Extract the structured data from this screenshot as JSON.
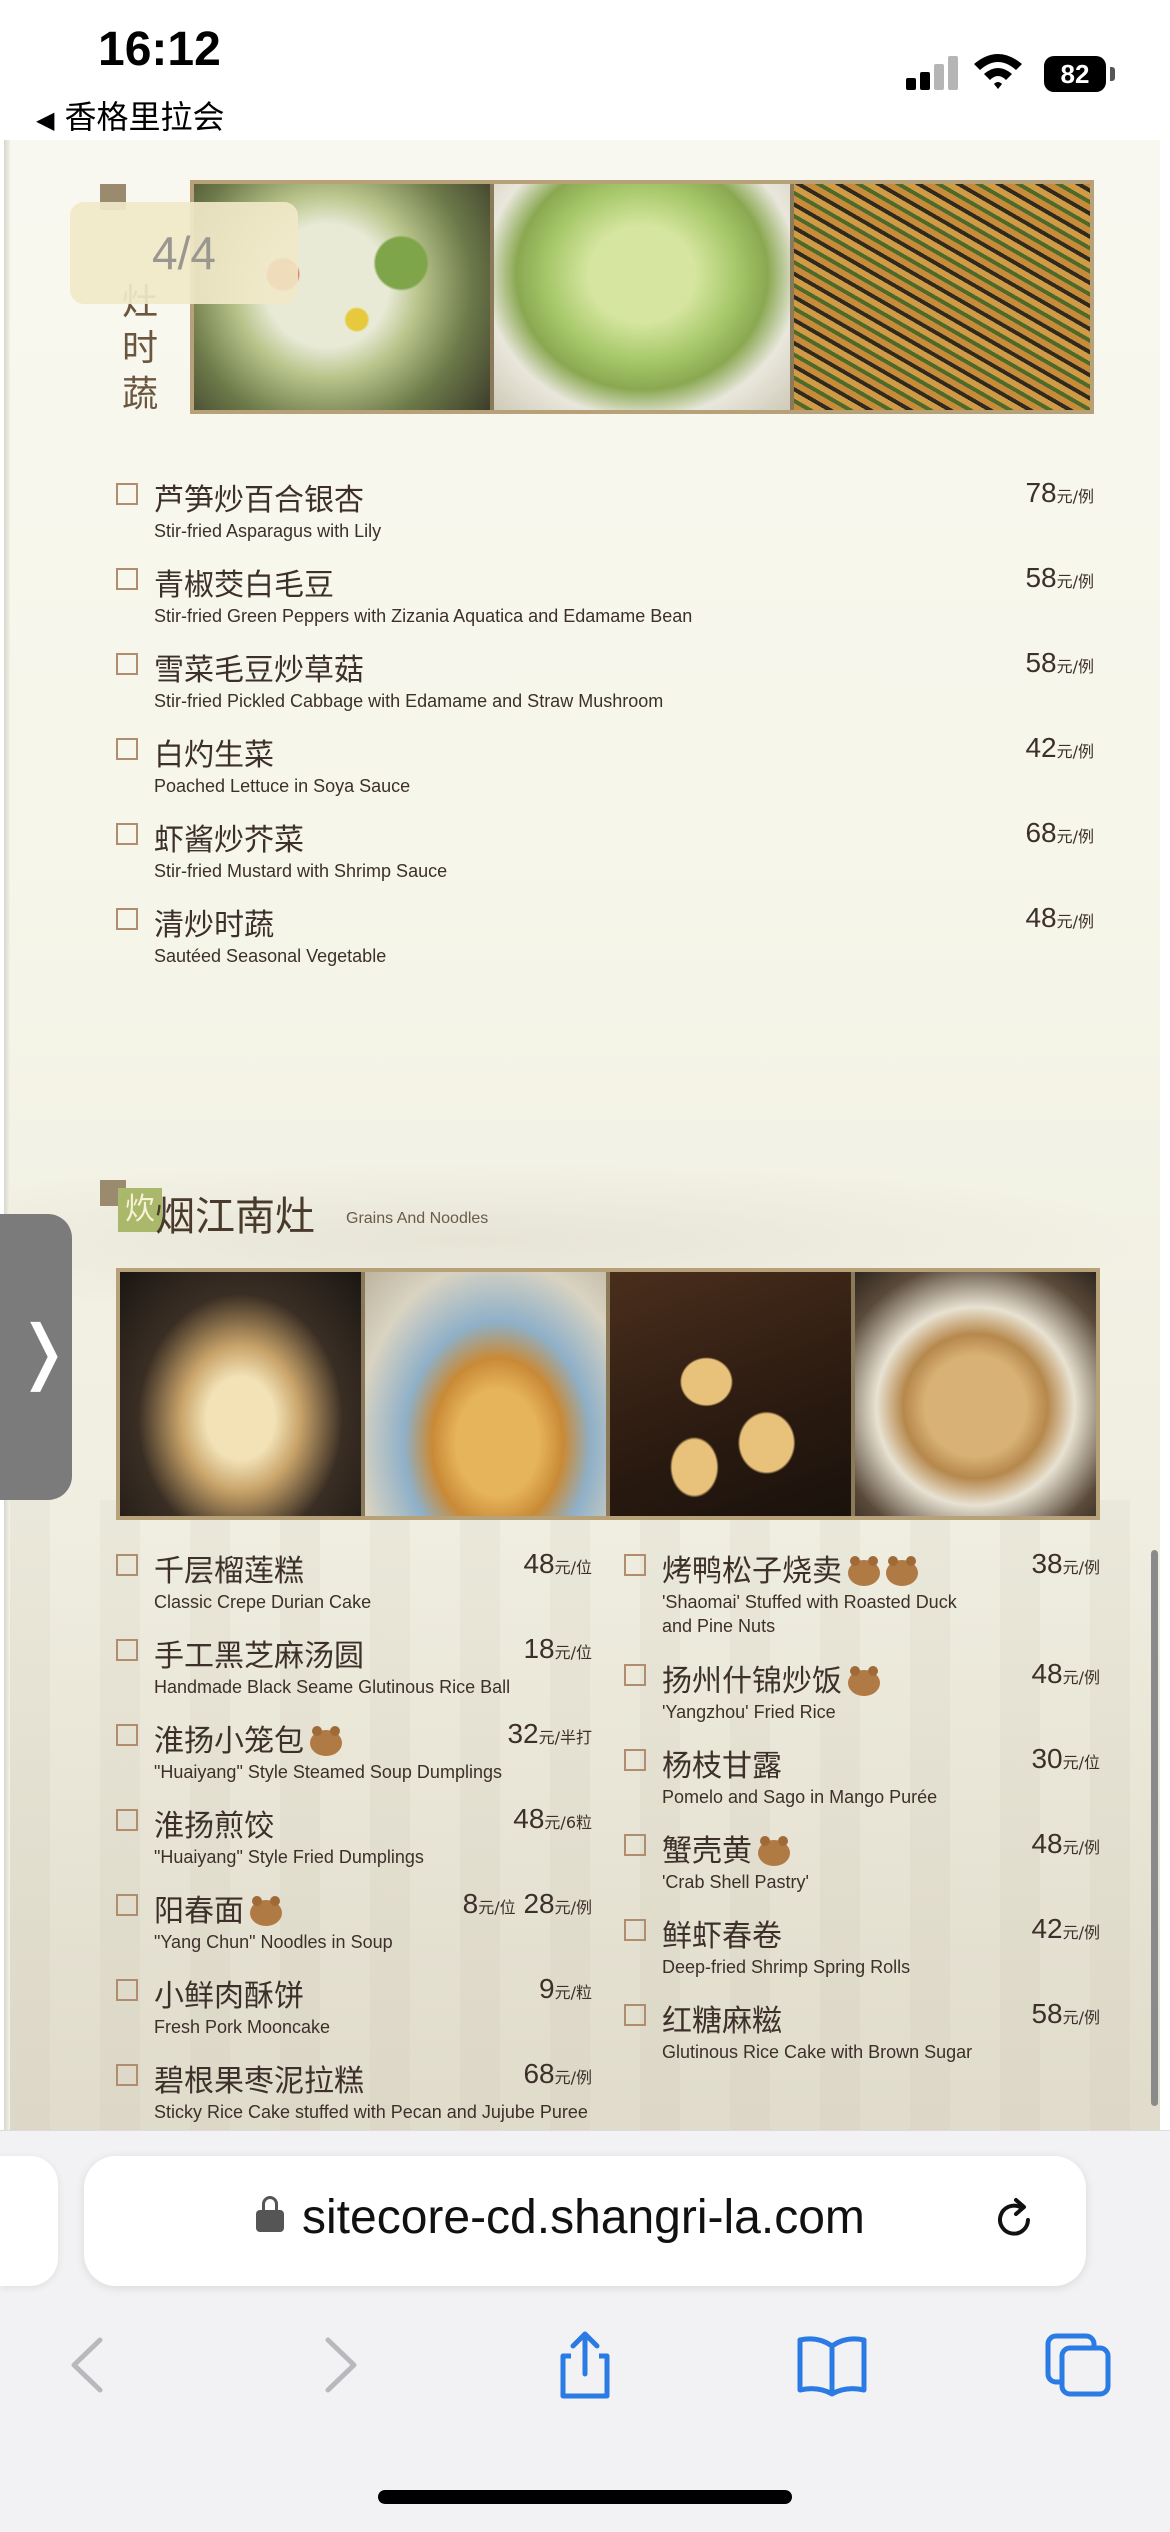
{
  "status_bar": {
    "time": "16:12",
    "back_app": "香格里拉会",
    "battery": "82"
  },
  "page_indicator": "4/4",
  "vegetables": {
    "title_chars": [
      "灶",
      "时",
      "蔬"
    ],
    "items": [
      {
        "zh": "芦笋炒百合银杏",
        "en": "Stir-fried Asparagus with Lily",
        "price": "78",
        "unit": "元/例"
      },
      {
        "zh": "青椒茭白毛豆",
        "en": "Stir-fried Green Peppers with Zizania Aquatica and Edamame Bean",
        "price": "58",
        "unit": "元/例"
      },
      {
        "zh": "雪菜毛豆炒草菇",
        "en": "Stir-fried Pickled Cabbage with Edamame and Straw Mushroom",
        "price": "58",
        "unit": "元/例"
      },
      {
        "zh": "白灼生菜",
        "en": "Poached Lettuce in Soya Sauce",
        "price": "42",
        "unit": "元/例"
      },
      {
        "zh": "虾酱炒芥菜",
        "en": "Stir-fried Mustard with Shrimp Sauce",
        "price": "68",
        "unit": "元/例"
      },
      {
        "zh": "清炒时蔬",
        "en": "Sautéed Seasonal Vegetable",
        "price": "48",
        "unit": "元/例"
      }
    ]
  },
  "grains": {
    "seal": "炊",
    "title": "烟江南灶",
    "title_en": "Grains And Noodles",
    "left": [
      {
        "zh": "千层榴莲糕",
        "en": "Classic Crepe Durian Cake",
        "price": "48",
        "unit": "元/位"
      },
      {
        "zh": "手工黑芝麻汤圆",
        "en": "Handmade Black Seame Glutinous Rice Ball",
        "price": "18",
        "unit": "元/位"
      },
      {
        "zh": "淮扬小笼包",
        "en": "\"Huaiyang\" Style Steamed Soup Dumplings",
        "price": "32",
        "unit": "元/半打",
        "bear": true
      },
      {
        "zh": "淮扬煎饺",
        "en": "\"Huaiyang\" Style Fried Dumplings",
        "price": "48",
        "unit": "元/6粒"
      },
      {
        "zh": "阳春面",
        "en": "\"Yang Chun\" Noodles in Soup",
        "price": "8",
        "unit": "元/位",
        "price2": "28",
        "unit2": "元/例",
        "bear": true
      },
      {
        "zh": "小鲜肉酥饼",
        "en": "Fresh Pork Mooncake",
        "price": "9",
        "unit": "元/粒"
      },
      {
        "zh": "碧根果枣泥拉糕",
        "en": "Sticky Rice Cake stuffed with Pecan and Jujube Puree",
        "price": "68",
        "unit": "元/例"
      }
    ],
    "right": [
      {
        "zh": "烤鸭松子烧卖",
        "en": "'Shaomai' Stuffed with Roasted Duck",
        "en2": "and Pine Nuts",
        "price": "38",
        "unit": "元/例",
        "bear": true,
        "bear2": true
      },
      {
        "zh": "扬州什锦炒饭",
        "en": "'Yangzhou' Fried Rice",
        "price": "48",
        "unit": "元/例",
        "bear": true
      },
      {
        "zh": "杨枝甘露",
        "en": "Pomelo and Sago in Mango Purée",
        "price": "30",
        "unit": "元/位"
      },
      {
        "zh": "蟹壳黄",
        "en": "'Crab Shell Pastry'",
        "price": "48",
        "unit": "元/例",
        "bear": true
      },
      {
        "zh": "鲜虾春卷",
        "en": "Deep-fried Shrimp Spring Rolls",
        "price": "42",
        "unit": "元/例"
      },
      {
        "zh": "红糖麻糍",
        "en": "Glutinous Rice Cake with Brown Sugar",
        "price": "58",
        "unit": "元/例"
      }
    ]
  },
  "browser": {
    "url": "sitecore-cd.shangri-la.com"
  },
  "colors": {
    "accent": "#b6a179",
    "page_bg": "#f6f6ea",
    "bear": "#b07a45"
  }
}
